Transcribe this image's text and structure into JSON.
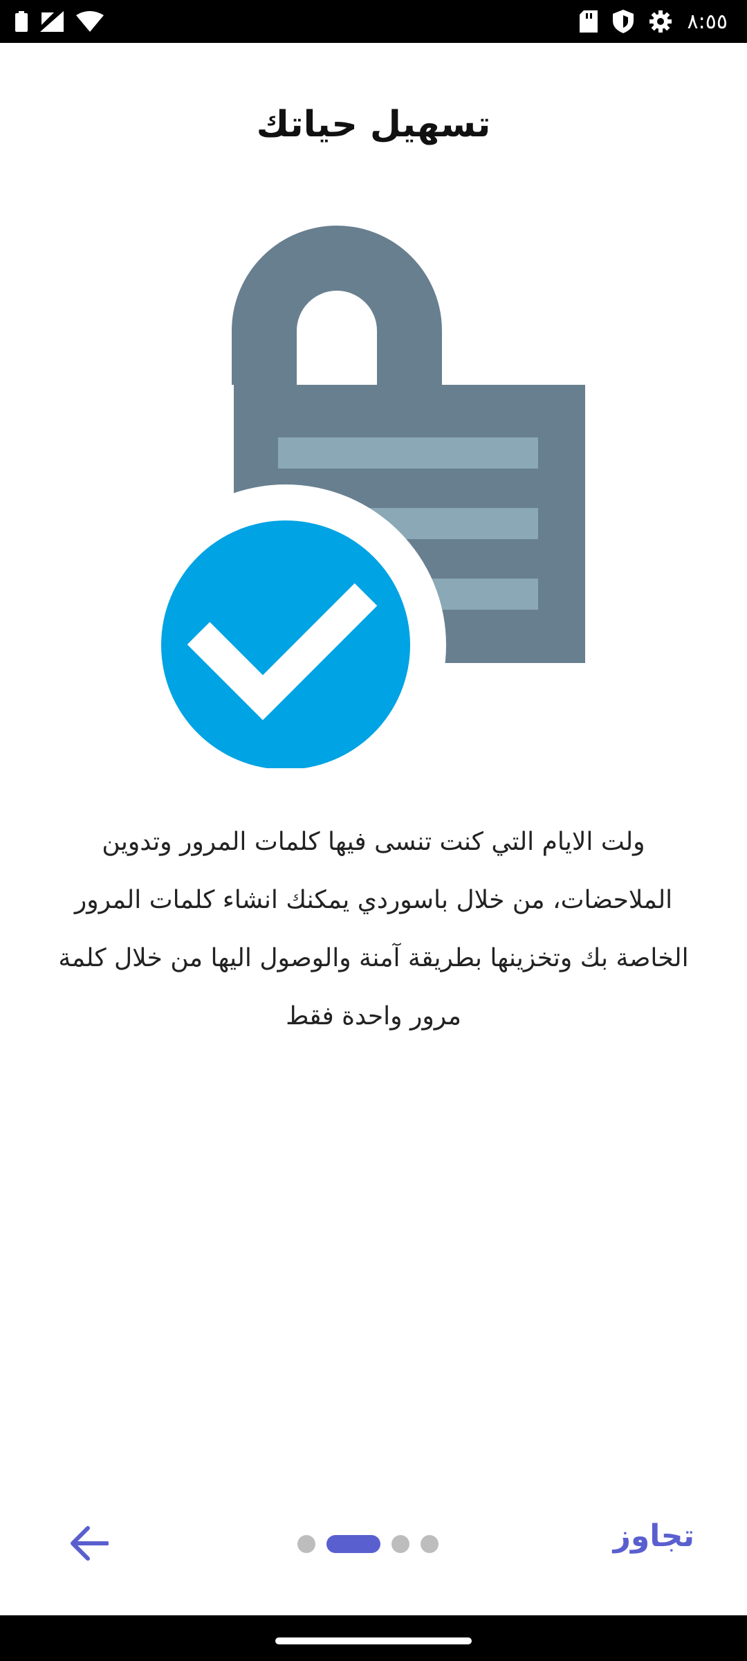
{
  "status_bar": {
    "time": "٨:٥٥",
    "left_icons": [
      "battery-icon",
      "signal-icon",
      "wifi-icon"
    ],
    "right_icons": [
      "sd-card-icon",
      "shield-icon",
      "settings-icon"
    ]
  },
  "onboarding": {
    "title": "تسهيل حياتك",
    "illustration": "lock-check-icon",
    "description": "ولت الايام التي كنت تنسى فيها كلمات المرور وتدوين الملاحضات، من خلال باسوردي يمكنك انشاء كلمات المرور الخاصة بك وتخزينها بطريقة آمنة والوصول اليها من خلال كلمة مرور واحدة فقط"
  },
  "pager": {
    "pages": 4,
    "active_index": 1
  },
  "nav": {
    "back_icon": "arrow-left-icon",
    "skip_label": "تجاوز"
  },
  "colors": {
    "accent": "#5a5fcf",
    "lock": "#687f90",
    "lock_stripes": "#8aa8b5",
    "check_circle": "#00a3e3",
    "dot_inactive": "#bdbdbd"
  }
}
